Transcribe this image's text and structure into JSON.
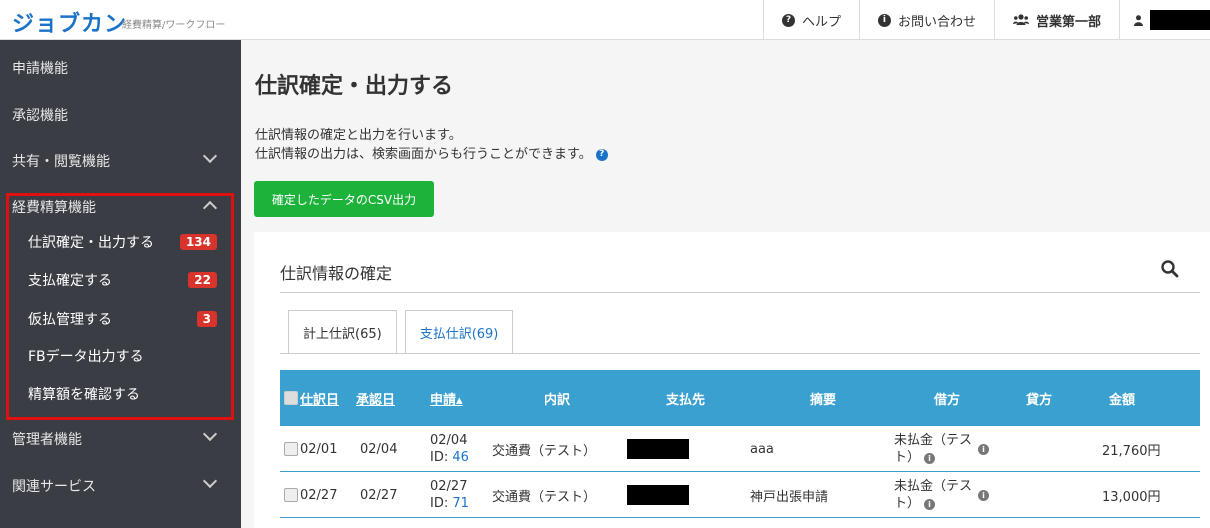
{
  "header": {
    "logo": "ジョブカン",
    "logo_sub": "経費精算/ワークフロー",
    "help": "ヘルプ",
    "contact": "お問い合わせ",
    "department": "営業第一部"
  },
  "sidebar": {
    "items": [
      {
        "label": "申請機能"
      },
      {
        "label": "承認機能"
      },
      {
        "label": "共有・閲覧機能"
      },
      {
        "label": "経費精算機能"
      },
      {
        "label": "管理者機能"
      },
      {
        "label": "関連サービス"
      }
    ],
    "sub_items": [
      {
        "label": "仕訳確定・出力する",
        "badge": "134"
      },
      {
        "label": "支払確定する",
        "badge": "22"
      },
      {
        "label": "仮払管理する",
        "badge": "3"
      },
      {
        "label": "FBデータ出力する",
        "badge": ""
      },
      {
        "label": "精算額を確認する",
        "badge": ""
      }
    ]
  },
  "main": {
    "title": "仕訳確定・出力する",
    "desc_line1": "仕訳情報の確定と出力を行います。",
    "desc_line2": "仕訳情報の出力は、検索画面からも行うことができます。",
    "csv_button": "確定したデータのCSV出力",
    "panel_title": "仕訳情報の確定",
    "tabs": [
      {
        "label": "計上仕訳(65)"
      },
      {
        "label": "支払仕訳(69)"
      }
    ],
    "table": {
      "headers": {
        "date": "仕訳日",
        "approved": "承認日",
        "applied": "申請▴",
        "detail": "内訳",
        "payee": "支払先",
        "summary": "摘要",
        "debit": "借方",
        "credit": "貸方",
        "amount": "金額"
      },
      "rows": [
        {
          "date": "02/01",
          "approved": "02/04",
          "applied_date": "02/04",
          "id_prefix": "ID:",
          "id": "46",
          "detail": "交通費（テスト）",
          "summary": "aaa",
          "debit_line1": "未払金（テス",
          "debit_line2": "ト）",
          "amount": "21,760円"
        },
        {
          "date": "02/27",
          "approved": "02/27",
          "applied_date": "02/27",
          "id_prefix": "ID:",
          "id": "71",
          "detail": "交通費（テスト）",
          "summary": "神戸出張申請",
          "debit_line1": "未払金（テス",
          "debit_line2": "ト）",
          "amount": "13,000円"
        }
      ]
    }
  }
}
